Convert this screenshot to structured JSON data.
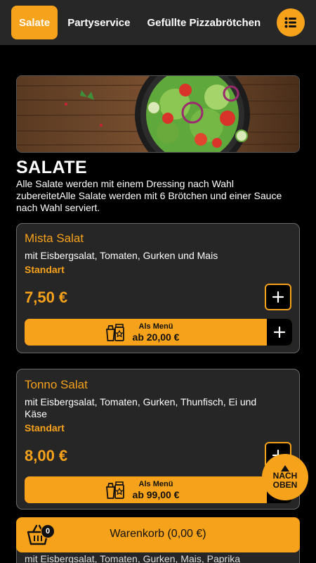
{
  "nav": {
    "tabs": [
      {
        "label": "Salate",
        "active": true
      },
      {
        "label": "Partyservice",
        "active": false
      },
      {
        "label": "Gefüllte Pizzabrötchen",
        "active": false
      }
    ],
    "menu_icon": "list-icon"
  },
  "category": {
    "title": "SALATE",
    "description": "Alle Salate werden mit einem Dressing nach Wahl zubereitetAlle Salate werden mit 6 Brötchen und einer Sauce nach Wahl serviert."
  },
  "products": [
    {
      "name": "Mista Salat",
      "description": "mit Eisbergsalat, Tomaten, Gurken und Mais",
      "variant": "Standart",
      "price": "7,50 €",
      "menu_label": "Als Menü",
      "menu_price": "ab 20,00 €"
    },
    {
      "name": "Tonno Salat",
      "description": "mit Eisbergsalat, Tomaten, Gurken, Thunfisch, Ei und Käse",
      "variant": "Standart",
      "price": "8,00 €",
      "menu_label": "Als Menü",
      "menu_price": "ab 99,00 €"
    }
  ],
  "next_product_peek": "mit Eisbergsalat, Tomaten, Gurken, Mais, Paprika",
  "back_to_top": {
    "line1": "NACH",
    "line2": "OBEN"
  },
  "cart": {
    "label": "Warenkorb (0,00 €)",
    "count": "0"
  },
  "colors": {
    "accent": "#f7a21b",
    "background": "#000000",
    "card": "#262626",
    "nav": "#272727"
  }
}
